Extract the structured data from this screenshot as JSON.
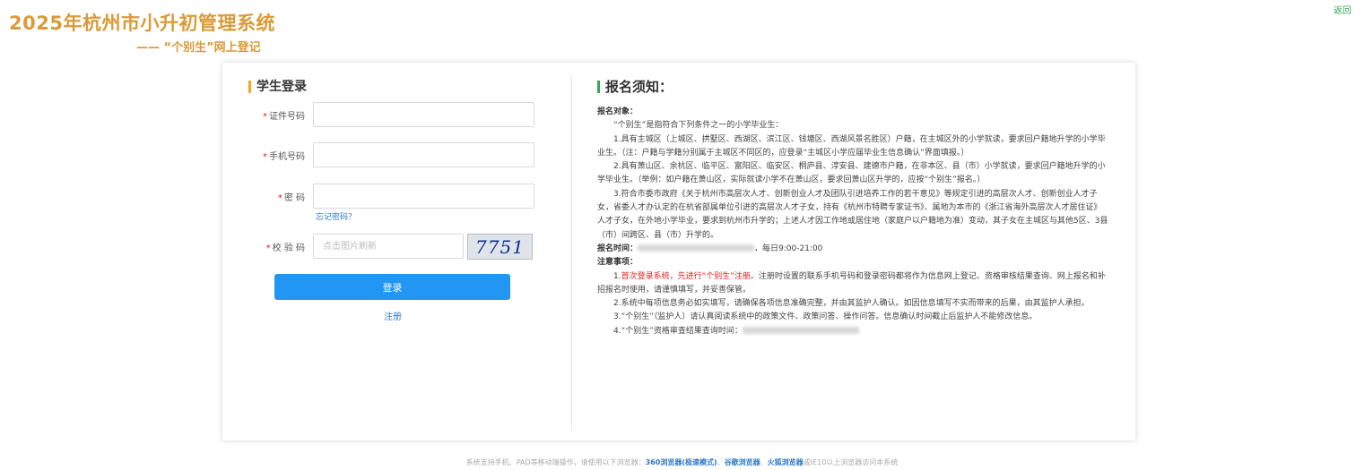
{
  "header": {
    "title": "2025年杭州市小升初管理系统",
    "subtitle": "—— “个别生”网上登记",
    "back_label": "返回"
  },
  "login": {
    "title": "学生登录",
    "required_mark": "*",
    "id_label": "证件号码",
    "phone_label": "手机号码",
    "password_label": "密 码",
    "forgot_password": "忘记密码？",
    "captcha_label": "校 验 码",
    "captcha_placeholder": "点击图片刷新",
    "captcha_text": "7751",
    "login_button": "登录",
    "register_link": "注册"
  },
  "notice": {
    "title": "报名须知：",
    "target_heading": "报名对象：",
    "intro": "“个别生”是指符合下列条件之一的小学毕业生：",
    "item1": "1.具有主城区（上城区、拱墅区、西湖区、滨江区、钱塘区、西湖风景名胜区）户籍，在主城区外的小学就读，要求回户籍地升学的小学毕业生。（注：户籍与学籍分别属于主城区不同区的，应登录“主城区小学应届毕业生信息确认”界面填报。）",
    "item2": "2.具有萧山区、余杭区、临平区、富阳区、临安区、桐庐县、淳安县、建德市户籍，在非本区、县（市）小学就读，要求回户籍地升学的小学毕业生。（举例：如户籍在萧山区，实际就读小学不在萧山区，要求回萧山区升学的，应按“个别生”报名。）",
    "item3": "3.符合市委市政府《关于杭州市高层次人才、创新创业人才及团队引进培养工作的若干意见》等规定引进的高层次人才、创新创业人才子女，省委人才办认定的在杭省部属单位引进的高层次人才子女，持有《杭州市特聘专家证书》、属地为本市的《浙江省海外高层次人才居住证》人才子女，在外地小学毕业，要求到杭州市升学的；上述人才因工作地或居住地（家庭户以户籍地为准）变动，其子女在主城区与其他5区、3县（市）间跨区、县（市）升学的。",
    "time_heading": "报名时间：",
    "time_suffix": "，每日9:00-21:00",
    "notes_heading": "注意事项：",
    "note1_prefix": "1.",
    "note1_red": "首次登录系统，先进行“个别生”注册。",
    "note1_rest": "注册时设置的联系手机号码和登录密码都将作为信息网上登记、资格审核结果查询、网上报名和补招报名时使用，请谨慎填写，并妥善保管。",
    "note2": "2.系统中每项信息务必如实填写，请确保各项信息准确完整，并由其监护人确认。如因信息填写不实而带来的后果，由其监护人承担。",
    "note3": "3.“个别生”（监护人）请认真阅读系统中的政策文件、政策问答、操作问答。信息确认时间截止后监护人不能修改信息。",
    "note4": "4.“个别生”资格审查结果查询时间："
  },
  "footer": {
    "prefix": "系统支持手机、PAD等移动端操作，请使用以下浏览器：",
    "browser1": "360浏览器(极速模式)",
    "sep1": "、",
    "browser2": "谷歌浏览器",
    "sep2": "、",
    "browser3": "火狐浏览器",
    "suffix": "或IE10以上浏览器访问本系统"
  },
  "colors": {
    "title": "#d99a38",
    "accent_orange": "#f5a623",
    "accent_green": "#3aa657",
    "button_blue": "#2196f3",
    "link_blue": "#2f78c4",
    "required_red": "#e02020"
  }
}
